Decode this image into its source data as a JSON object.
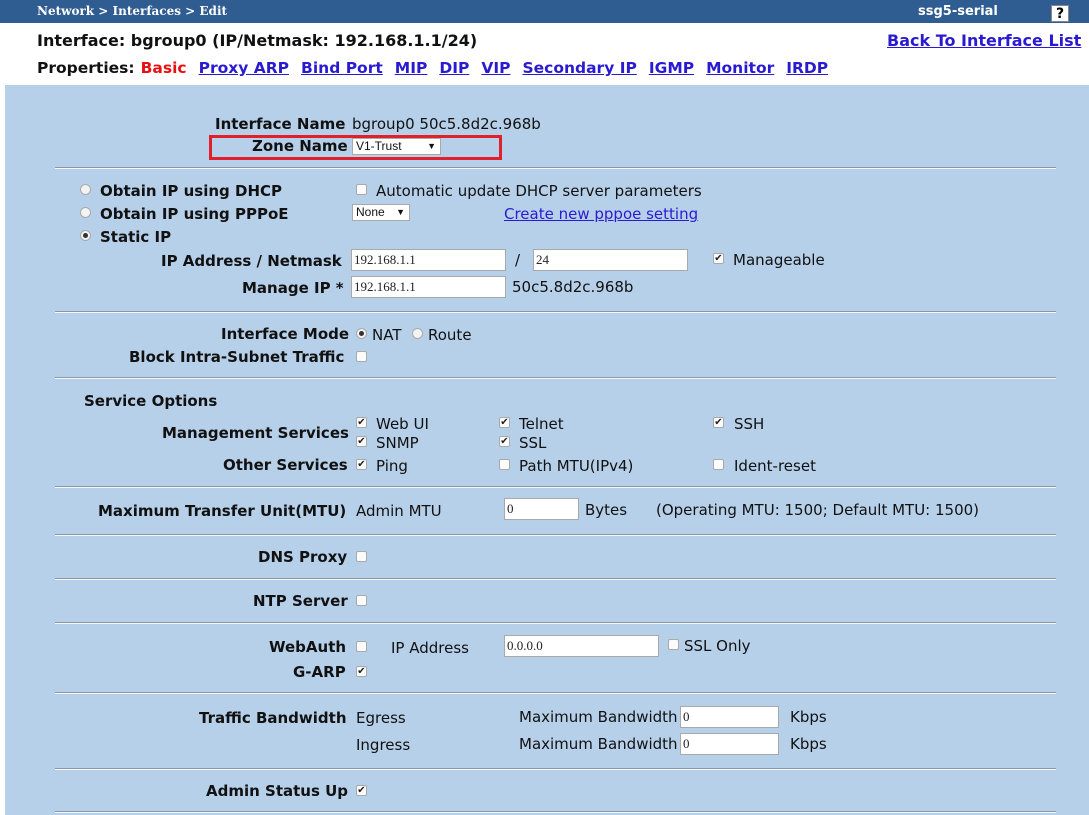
{
  "topbar": {
    "breadcrumb": "Network > Interfaces > Edit",
    "device": "ssg5-serial",
    "help": "?"
  },
  "header": {
    "interface_title": "Interface: bgroup0 (IP/Netmask: 192.168.1.1/24)",
    "back_link": "Back To Interface List"
  },
  "properties": {
    "label": "Properties:",
    "current": "Basic",
    "links": [
      "Proxy ARP",
      "Bind Port",
      "MIP",
      "DIP",
      "VIP",
      "Secondary IP",
      "IGMP",
      "Monitor",
      "IRDP"
    ]
  },
  "iface": {
    "name_label": "Interface Name",
    "name_value": "bgroup0 50c5.8d2c.968b",
    "zone_label": "Zone Name",
    "zone_value": "V1-Trust"
  },
  "ip": {
    "dhcp_label": "Obtain IP using DHCP",
    "dhcp_checked": false,
    "auto_update_label": "Automatic update DHCP server parameters",
    "auto_update_checked": false,
    "pppoe_label": "Obtain IP using PPPoE",
    "pppoe_checked": false,
    "pppoe_select": "None",
    "pppoe_link": "Create new pppoe setting",
    "static_label": "Static IP",
    "static_checked": true,
    "ipmask_label": "IP Address / Netmask",
    "ip_value": "192.168.1.1",
    "slash": "/",
    "mask_value": "24",
    "manageable_label": "Manageable",
    "manageable_checked": true,
    "manage_ip_label": "Manage IP *",
    "manage_ip_value": "192.168.1.1",
    "manage_mac": "50c5.8d2c.968b"
  },
  "mode": {
    "label": "Interface Mode",
    "nat_label": "NAT",
    "nat_checked": true,
    "route_label": "Route",
    "route_checked": false,
    "block_label": "Block Intra-Subnet Traffic",
    "block_checked": false
  },
  "services": {
    "title": "Service Options",
    "mgmt_label": "Management Services",
    "webui": "Web UI",
    "webui_checked": true,
    "telnet": "Telnet",
    "telnet_checked": true,
    "ssh": "SSH",
    "ssh_checked": true,
    "snmp": "SNMP",
    "snmp_checked": true,
    "ssl": "SSL",
    "ssl_checked": true,
    "other_label": "Other Services",
    "ping": "Ping",
    "ping_checked": true,
    "pathmtu": "Path MTU(IPv4)",
    "pathmtu_checked": false,
    "ident": "Ident-reset",
    "ident_checked": false
  },
  "mtu": {
    "label": "Maximum Transfer Unit(MTU)",
    "admin_label": "Admin MTU",
    "value": "0",
    "unit": "Bytes",
    "info": "(Operating MTU: 1500; Default MTU: 1500)"
  },
  "dns": {
    "label": "DNS Proxy",
    "checked": false
  },
  "ntp": {
    "label": "NTP Server",
    "checked": false
  },
  "webauth": {
    "label": "WebAuth",
    "checked": false,
    "ip_label": "IP Address",
    "ip_value": "0.0.0.0",
    "ssl_label": "SSL Only",
    "ssl_checked": false,
    "garp_label": "G-ARP",
    "garp_checked": true
  },
  "bandwidth": {
    "label": "Traffic Bandwidth",
    "egress": "Egress",
    "ingress": "Ingress",
    "max_label": "Maximum Bandwidth",
    "egress_value": "0",
    "ingress_value": "0",
    "unit": "Kbps"
  },
  "admin": {
    "label": "Admin Status Up",
    "checked": true
  },
  "glyphs": {
    "check": "✔",
    "arrow": "▼"
  },
  "colors": {
    "topbar": "#2f5d92",
    "panel": "#b7d0ea",
    "link": "#2a1bd0",
    "current": "#e81010",
    "highlight": "#e0202a"
  }
}
